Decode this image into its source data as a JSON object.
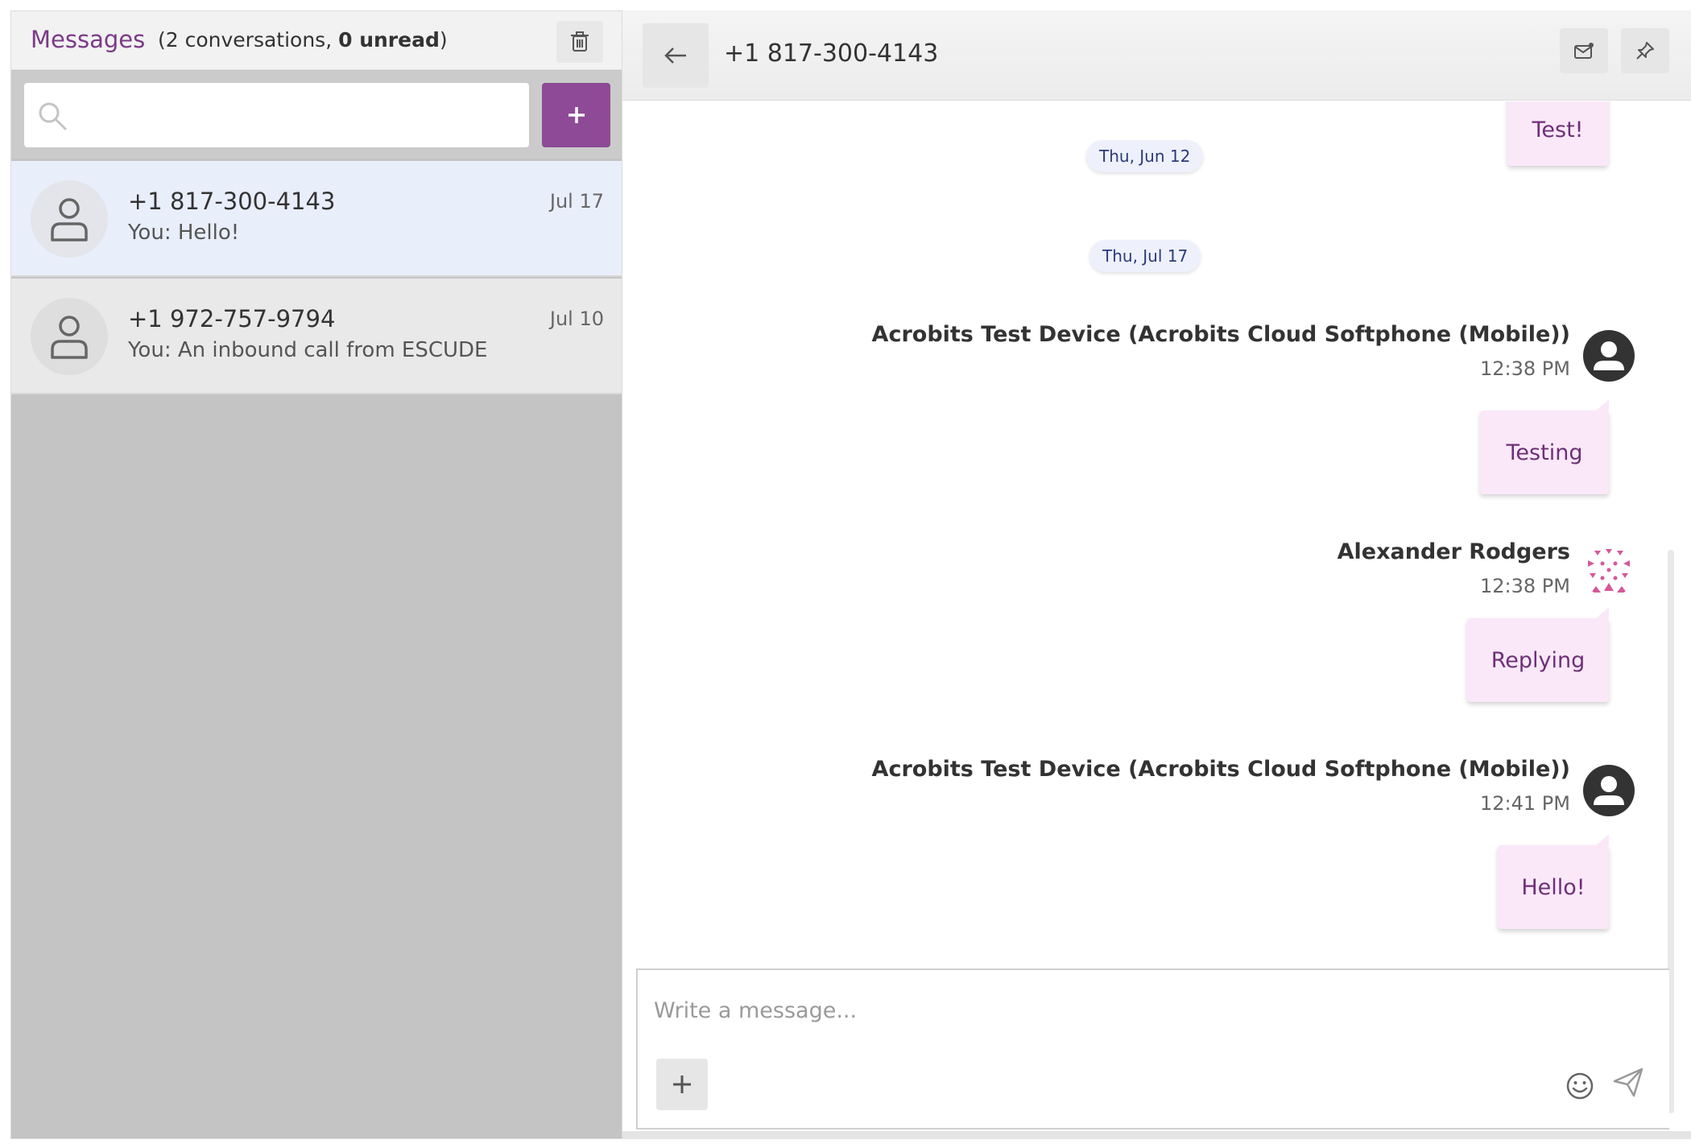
{
  "left": {
    "title": "Messages",
    "summary_prefix": "(2 conversations, ",
    "summary_unread": "0 unread",
    "summary_suffix": ")",
    "search_placeholder": ""
  },
  "conversations": [
    {
      "name": "+1 817-300-4143",
      "date": "Jul 17",
      "preview": "You: Hello!"
    },
    {
      "name": "+1 972-757-9794",
      "date": "Jul 10",
      "preview": "You: An inbound call from ESCUDE"
    }
  ],
  "thread": {
    "title": "+1 817-300-4143",
    "date_dividers": [
      "Thu, Jun 12",
      "Thu, Jul 17"
    ],
    "messages": [
      {
        "text": "Test!"
      },
      {
        "sender": "Acrobits Test Device (Acrobits Cloud Softphone (Mobile))",
        "time": "12:38 PM",
        "text": "Testing"
      },
      {
        "sender": "Alexander Rodgers",
        "time": "12:38 PM",
        "text": "Replying"
      },
      {
        "sender": "Acrobits Test Device (Acrobits Cloud Softphone (Mobile))",
        "time": "12:41 PM",
        "text": "Hello!"
      }
    ]
  },
  "composer": {
    "placeholder": "Write a message..."
  },
  "colors": {
    "accent": "#8e4a96",
    "bubble": "#fae8f8",
    "bubble_text": "#6e2f78",
    "selected_row": "#e9eefb"
  },
  "icons": [
    "trash-icon",
    "search-icon",
    "plus-icon",
    "person-icon",
    "back-arrow-icon",
    "mail-icon",
    "pin-icon",
    "emoji-icon",
    "send-icon"
  ]
}
